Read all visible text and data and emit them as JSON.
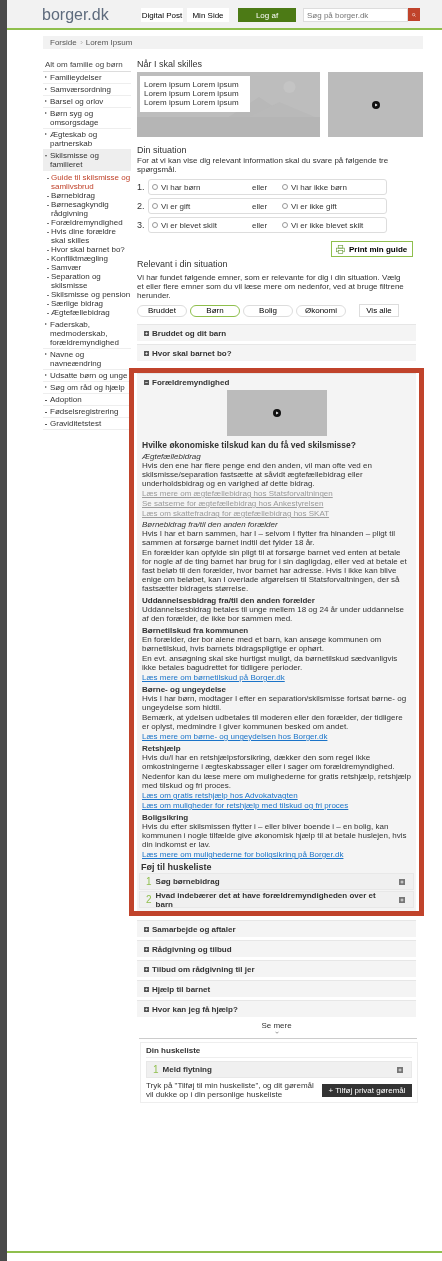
{
  "header": {
    "logo": "borger.dk",
    "nav": [
      "Digital Post",
      "Min Side"
    ],
    "logout": "Log af",
    "search_placeholder": "Søg på borger.dk"
  },
  "breadcrumb": [
    "Forside",
    "Lorem Ipsum"
  ],
  "sidebar": {
    "title": "Alt om familie og børn",
    "items": [
      {
        "kind": "group",
        "label": "Familieydelser",
        "expanded": false
      },
      {
        "kind": "group",
        "label": "Samværsordning",
        "expanded": false
      },
      {
        "kind": "group",
        "label": "Barsel og orlov",
        "expanded": false
      },
      {
        "kind": "group",
        "label": "Børn syg og omsorgsdage",
        "expanded": false
      },
      {
        "kind": "group",
        "label": "Ægteskab og partnerskab",
        "expanded": false
      },
      {
        "kind": "group",
        "label": "Skilsmisse og familieret",
        "expanded": true,
        "children": [
          {
            "label": "Guide til skilsmisse og samlivsbrud",
            "selected": true
          },
          {
            "label": "Børnebidrag",
            "selected": false
          },
          {
            "label": "Børnesagkyndig rådgivning",
            "selected": false
          },
          {
            "label": "Forældremyndighed",
            "selected": false
          },
          {
            "label": "Hvis dine forældre skal skilles",
            "selected": false
          },
          {
            "label": "Hvor skal barnet bo?",
            "selected": false
          },
          {
            "label": "Konfliktmægling",
            "selected": false
          },
          {
            "label": "Samvær",
            "selected": false
          },
          {
            "label": "Separation og skilsmisse",
            "selected": false
          },
          {
            "label": "Skilsmisse og pension",
            "selected": false
          },
          {
            "label": "Særlige bidrag",
            "selected": false
          },
          {
            "label": "Ægtefællebidrag",
            "selected": false
          }
        ]
      },
      {
        "kind": "group",
        "label": "Faderskab, medmoderskab, forældremyndighed",
        "expanded": false
      },
      {
        "kind": "group",
        "label": "Navne og navneændring",
        "expanded": false
      },
      {
        "kind": "group",
        "label": "Udsatte børn og unge",
        "expanded": false
      },
      {
        "kind": "group",
        "label": "Søg om råd og hjælp",
        "expanded": false
      },
      {
        "kind": "link",
        "label": "Adoption"
      },
      {
        "kind": "link",
        "label": "Fødselsregistrering"
      },
      {
        "kind": "link",
        "label": "Graviditetstest"
      }
    ]
  },
  "main": {
    "title": "Når I skal skilles",
    "hero_lines": [
      "Lorem ipsum Lorem ipsum",
      "Lorem ipsum Lorem ipsum",
      "Lorem ipsum Lorem ipsum"
    ],
    "situation_title": "Din situation",
    "situation_intro": "For at vi kan vise dig relevant information skal du svare på følgende tre spørgsmål.",
    "questions": [
      {
        "number": "1.",
        "or": "eller",
        "options": [
          {
            "label": "Vi har børn",
            "selected": false
          },
          {
            "label": "Vi har ikke børn",
            "selected": false
          }
        ]
      },
      {
        "number": "2.",
        "or": "eller",
        "options": [
          {
            "label": "Vi er gift",
            "selected": false
          },
          {
            "label": "Vi er ikke gift",
            "selected": false
          }
        ]
      },
      {
        "number": "3.",
        "or": "eller",
        "options": [
          {
            "label": "Vi er blevet skilt",
            "selected": false
          },
          {
            "label": "Vi er ikke blevet skilt",
            "selected": false
          }
        ]
      }
    ],
    "print_button": "Print min guide",
    "relevant_title": "Relevant i din situation",
    "relevant_intro": "Vi har fundet følgende emner, som er relevante for dig i din situation. Vælg et eller flere emner som du vil læse mere om nedenfor, ved at bruge filtrene herunder.",
    "filters": [
      {
        "label": "Bruddet",
        "selected": false
      },
      {
        "label": "Børn",
        "selected": true
      },
      {
        "label": "Bolig",
        "selected": false
      },
      {
        "label": "Økonomi",
        "selected": false
      }
    ],
    "show_all": "Vis alle",
    "sections": [
      {
        "title": "Bruddet og dit barn",
        "expanded": false,
        "highlighted": false
      },
      {
        "title": "Hvor skal barnet bo?",
        "expanded": false,
        "highlighted": false
      },
      {
        "title": "Forældremyndighed",
        "expanded": true,
        "highlighted": true,
        "content": [
          {
            "kind": "video"
          },
          {
            "kind": "title",
            "text": "Hvilke økonomiske tilskud kan du få ved skilsmisse?"
          },
          {
            "kind": "subtitle",
            "text": "Ægtefællebidrag"
          },
          {
            "kind": "para",
            "text": "Hvis den ene har flere penge end den anden, vil man ofte ved en skilsmisse/separation fastsætte at såvidt ægtefællebidrag eller underholdsbidrag og en varighed af dette bidrag."
          },
          {
            "kind": "link",
            "text": "Læs mere om ægtefællebidrag hos Statsforvaltningen",
            "muted": true
          },
          {
            "kind": "link",
            "text": "Se satserne for ægtefællebidrag hos Ankestyrelsen",
            "muted": true
          },
          {
            "kind": "link",
            "text": "Læs om skattefradrag for ægtefællebidrag hos SKAT",
            "muted": true
          },
          {
            "kind": "subtitle",
            "text": "Børnebidrag fra/til den anden forælder"
          },
          {
            "kind": "para",
            "text": "Hvis I har et barn sammen, har I – selvom I flytter fra hinanden – pligt til sammen at forsørge barnet indtil det fylder 18 år."
          },
          {
            "kind": "para",
            "text": "En forælder kan opfylde sin pligt til at forsørge barnet ved enten at betale for nogle af de ting barnet har brug for i sin dagligdag, eller ved at betale et fast beløb til den forælder, hvor barnet har adresse. Hvis I ikke kan blive enige om beløbet, kan I overlade afgørelsen til Statsforvaltningen, der så fastsætter bidragets størrelse."
          },
          {
            "kind": "heading",
            "text": "Uddannelsesbidrag fra/til den anden forælder"
          },
          {
            "kind": "para",
            "text": "Uddannelsesbidrag betales til unge mellem 18 og 24 år under uddannelse af den forælder, de ikke bor sammen med."
          },
          {
            "kind": "heading",
            "text": "Børnetilskud fra kommunen"
          },
          {
            "kind": "para",
            "text": "En forælder, der bor alene med et barn, kan ansøge kommunen om børnetilskud, hvis barnets bidragspligtige er ophørt."
          },
          {
            "kind": "para",
            "text": "En evt. ansøgning skal ske hurtigst muligt, da børnetilskud sædvanligvis ikke betales bagudrettet for tidligere perioder."
          },
          {
            "kind": "link",
            "text": "Læs mere om børnetilskud på Borger.dk",
            "muted": false
          },
          {
            "kind": "heading",
            "text": "Børne- og ungeydelse"
          },
          {
            "kind": "para",
            "text": "Hvis I har børn, modtager I efter en separation/skilsmisse fortsat børne- og ungeydelse som hidtil."
          },
          {
            "kind": "para",
            "text": "Bemærk, at ydelsen udbetales til moderen eller den forælder, der tidligere er oplyst, medmindre I giver kommunen besked om andet."
          },
          {
            "kind": "link",
            "text": "Læs mere om børne- og ungeydelsen hos Borger.dk",
            "muted": false
          },
          {
            "kind": "heading",
            "text": "Retshjælp"
          },
          {
            "kind": "para",
            "text": "Hvis du/I har en retshjælpsforsikring, dækker den som regel ikke omkostningerne i ægteskabssager eller i sager om forældremyndighed."
          },
          {
            "kind": "para",
            "text": "Nedenfor kan du læse mere om mulighederne for gratis retshjælp, retshjælp med tilskud og fri proces."
          },
          {
            "kind": "link",
            "text": "Læs om gratis retshjælp hos Advokatvagten",
            "muted": false
          },
          {
            "kind": "link",
            "text": "Læs om muligheder for retshjælp med tilskud og fri proces",
            "muted": false
          },
          {
            "kind": "heading",
            "text": "Boligsikring"
          },
          {
            "kind": "para",
            "text": "Hvis du efter skilsmissen flytter i – eller bliver boende i – en bolig, kan kommunen i nogle tilfælde give økonomisk hjælp til at betale huslejen, hvis din indkomst er lav."
          },
          {
            "kind": "link",
            "text": "Læs mere om mulighederne for boligsikring på Borger.dk",
            "muted": false
          },
          {
            "kind": "checklist",
            "title": "Føj til huskeliste",
            "items": [
              {
                "number": "1",
                "text": "Søg børnebidrag"
              },
              {
                "number": "2",
                "text": "Hvad indebærer det at have forældremyndigheden over et barn"
              }
            ]
          }
        ]
      },
      {
        "title": "Samarbejde og aftaler",
        "expanded": false,
        "highlighted": false
      },
      {
        "title": "Rådgivning og tilbud",
        "expanded": false,
        "highlighted": false
      },
      {
        "title": "Tilbud om rådgivning til jer",
        "expanded": false,
        "highlighted": false
      },
      {
        "title": "Hjælp til barnet",
        "expanded": false,
        "highlighted": false
      },
      {
        "title": "Hvor kan jeg få hjælp?",
        "expanded": false,
        "highlighted": false
      }
    ],
    "see_more": "Se mere",
    "huskeliste": {
      "title": "Din huskeliste",
      "items": [
        {
          "number": "1",
          "text": "Meld flytning"
        }
      ],
      "note": "Tryk på \"Tilføj til min huskeliste\", og dit gøremål vil dukke op i din personlige huskeliste",
      "button": "+ Tilføj privat gøremål"
    }
  }
}
